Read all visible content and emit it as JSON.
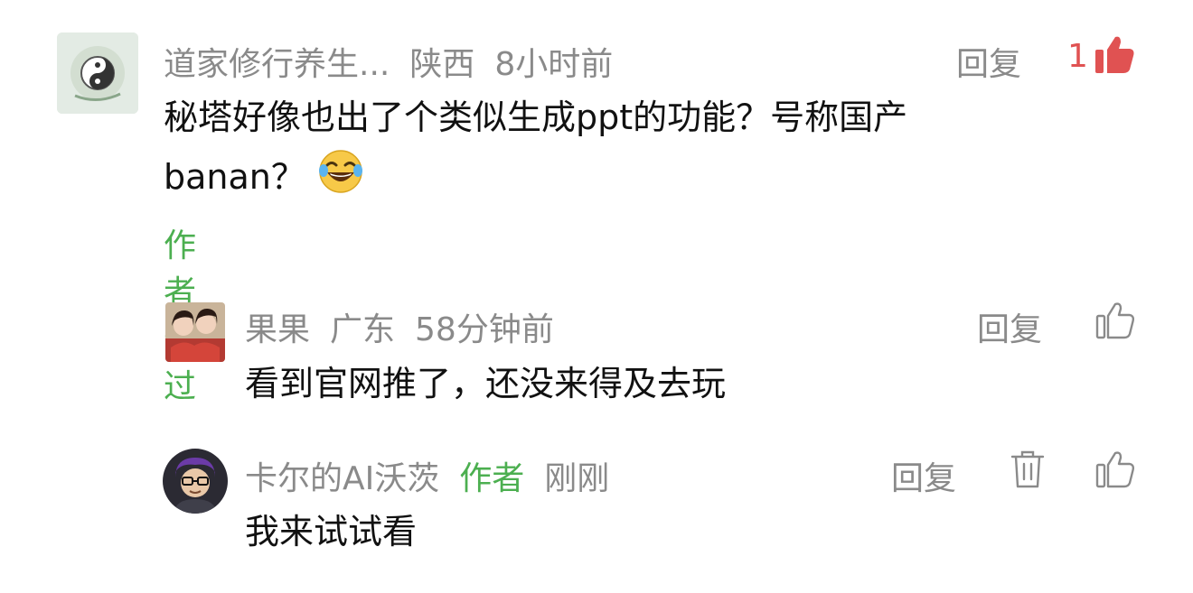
{
  "comments": [
    {
      "username": "道家修行养生...",
      "location": "陕西",
      "time": "8小时前",
      "text_line1": "秘塔好像也出了个类似生成ppt的功能？号称国产",
      "text_line2": "banan？",
      "author_liked": "作者赞过",
      "reply_label": "回复",
      "like_count": "1",
      "liked": true
    },
    {
      "username": "果果",
      "location": "广东",
      "time": "58分钟前",
      "text": "看到官网推了，还没来得及去玩",
      "reply_label": "回复",
      "liked": false
    },
    {
      "username": "卡尔的AI沃茨",
      "author_tag": "作者",
      "time": "刚刚",
      "text": "我来试试看",
      "reply_label": "回复",
      "liked": false
    }
  ],
  "colors": {
    "meta_gray": "#8a8a8a",
    "author_green": "#4caf50",
    "like_red": "#e05252"
  },
  "icons": [
    "thumb-up-filled-icon",
    "thumb-up-outline-icon",
    "trash-icon",
    "laughing-emoji-icon"
  ]
}
